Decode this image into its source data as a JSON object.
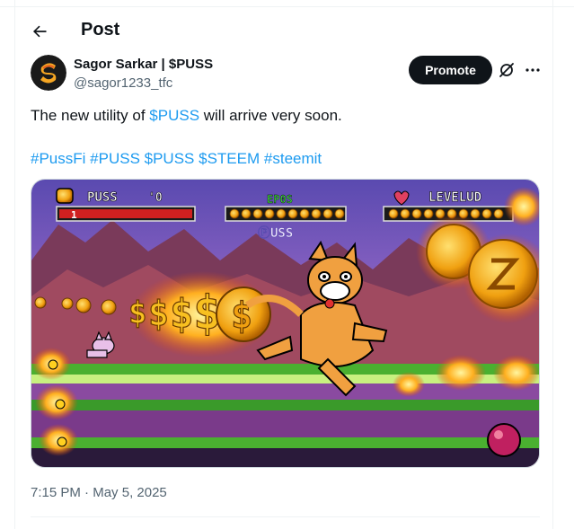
{
  "header": {
    "title": "Post"
  },
  "author": {
    "name": "Sagor Sarkar | $PUSS",
    "handle": "@sagor1233_tfc"
  },
  "actions": {
    "promote_label": "Promote"
  },
  "post": {
    "text_before": "The new utility of ",
    "text_link": "$PUSS",
    "text_after": " will arrive very soon.",
    "hashtags": [
      "#PussFi",
      "#PUSS",
      "$PUSS",
      "$STEEM",
      "#steemit"
    ]
  },
  "game_image": {
    "score_label": "PUSS",
    "score_value": "'0",
    "health_value": "1",
    "brand_text": "EP0S",
    "center_text": "ⓅUSS",
    "level_label": "LEVELUD"
  },
  "meta": {
    "time": "7:15 PM",
    "separator": " · ",
    "date": "May 5, 2025"
  },
  "colors": {
    "accent": "#1d9bf0",
    "text": "#0f1419",
    "muted": "#536471",
    "promote_bg": "#0f1419"
  }
}
